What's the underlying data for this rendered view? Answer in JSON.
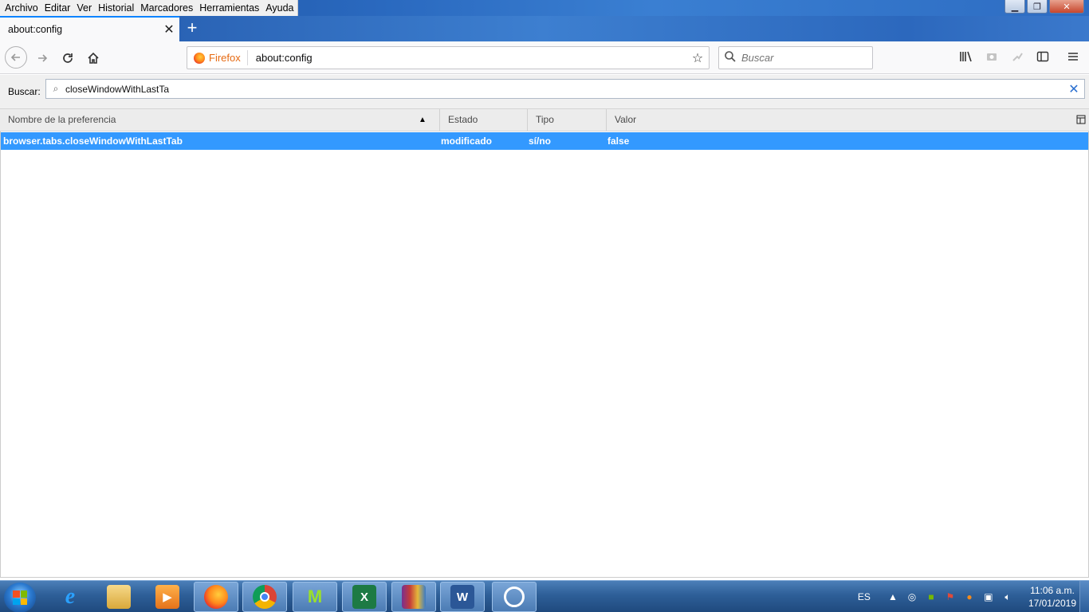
{
  "menubar": {
    "items": [
      "Archivo",
      "Editar",
      "Ver",
      "Historial",
      "Marcadores",
      "Herramientas",
      "Ayuda"
    ]
  },
  "window_controls": {
    "minimize": "▁",
    "maximize": "❐",
    "close": "✕"
  },
  "tab": {
    "title": "about:config",
    "close": "✕",
    "new_tab": "+"
  },
  "navbar": {
    "identity_label": "Firefox",
    "url": "about:config",
    "search_placeholder": "Buscar",
    "icons": [
      "back-icon",
      "forward-icon",
      "reload-icon",
      "home-icon",
      "bookmark-star-icon",
      "library-icon",
      "screenshot-icon",
      "extension-icon",
      "sidebar-icon",
      "hamburger-menu-icon"
    ]
  },
  "config_search": {
    "label": "Buscar:",
    "value": "closeWindowWithLastTa"
  },
  "table": {
    "columns": [
      "Nombre de la preferencia",
      "Estado",
      "Tipo",
      "Valor"
    ],
    "sort_column": "Nombre de la preferencia",
    "rows": [
      {
        "name": "browser.tabs.closeWindowWithLastTab",
        "state": "modificado",
        "type": "sí/no",
        "value": "false",
        "selected": true
      }
    ]
  },
  "taskbar": {
    "apps": [
      "internet-explorer",
      "file-explorer",
      "media-player",
      "firefox",
      "chrome",
      "movistar",
      "excel",
      "winrar",
      "word",
      "speedometer"
    ],
    "active_app": "firefox",
    "language": "ES",
    "time": "11:06 a.m.",
    "date": "17/01/2019"
  },
  "colors": {
    "selection": "#3399ff",
    "tab_accent": "#0a84ff",
    "firefox_label": "#e66a12",
    "taskbar": "#2e5f98"
  }
}
